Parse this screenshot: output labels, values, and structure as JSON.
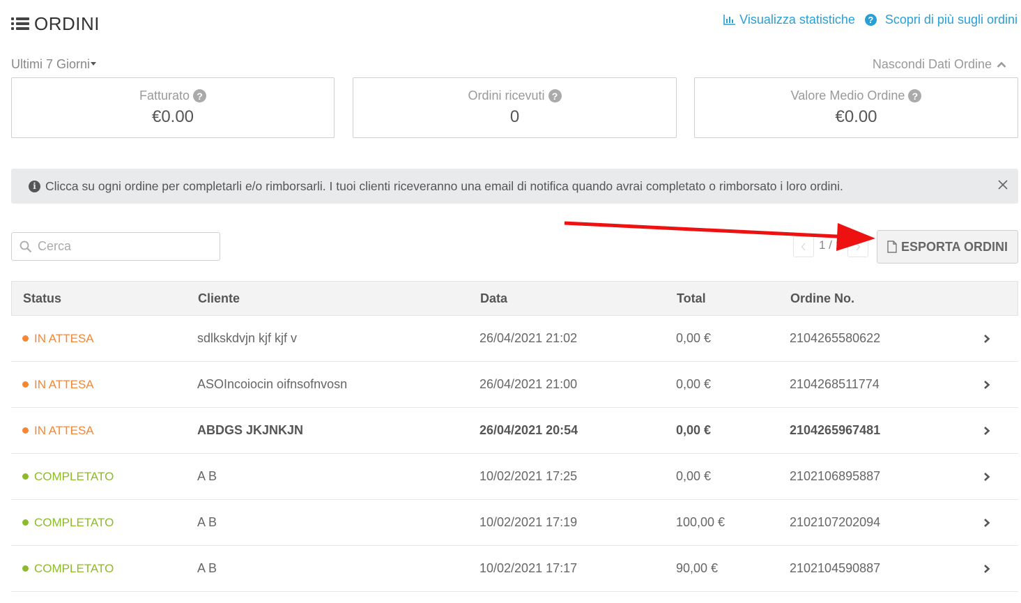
{
  "header": {
    "title": "ORDINI"
  },
  "top_links": {
    "stats": "Visualizza statistiche",
    "learn_more": "Scopri di più sugli ordini"
  },
  "period": {
    "selected": "Ultimi 7 Giorni"
  },
  "hide_data": "Nascondi Dati Ordine",
  "stats": [
    {
      "label": "Fatturato",
      "value": "€0.00"
    },
    {
      "label": "Ordini ricevuti",
      "value": "0"
    },
    {
      "label": "Valore Medio Ordine",
      "value": "€0.00"
    }
  ],
  "info": "Clicca su ogni ordine per completarli e/o rimborsarli. I tuoi clienti riceveranno una email di notifica quando avrai completato o rimborsato i loro ordini.",
  "search": {
    "placeholder": "Cerca"
  },
  "pager": {
    "text": "1 / 1"
  },
  "export_label": "ESPORTA ORDINI",
  "colors": {
    "pending": "#f58634",
    "completed": "#8dba2b",
    "link": "#2a9fd6",
    "arrow": "#ee1111"
  },
  "table": {
    "headers": [
      "Status",
      "Cliente",
      "Data",
      "Total",
      "Ordine No."
    ],
    "rows": [
      {
        "status": "IN ATTESA",
        "client": "sdlkskdvjn kjf kjf v",
        "date": "26/04/2021 21:02",
        "total": "0,00 €",
        "order": "2104265580622"
      },
      {
        "status": "IN ATTESA",
        "client": "ASOIncoiocin oifnsofnvosn",
        "date": "26/04/2021 21:00",
        "total": "0,00 €",
        "order": "2104268511774"
      },
      {
        "status": "IN ATTESA",
        "client": "ABDGS JKJNKJN",
        "date": "26/04/2021 20:54",
        "total": "0,00 €",
        "order": "2104265967481"
      },
      {
        "status": "COMPLETATO",
        "client": "A B",
        "date": "10/02/2021 17:25",
        "total": "0,00 €",
        "order": "2102106895887"
      },
      {
        "status": "COMPLETATO",
        "client": "A B",
        "date": "10/02/2021 17:19",
        "total": "100,00 €",
        "order": "2102107202094"
      },
      {
        "status": "COMPLETATO",
        "client": "A B",
        "date": "10/02/2021 17:17",
        "total": "90,00 €",
        "order": "2102104590887"
      }
    ]
  }
}
